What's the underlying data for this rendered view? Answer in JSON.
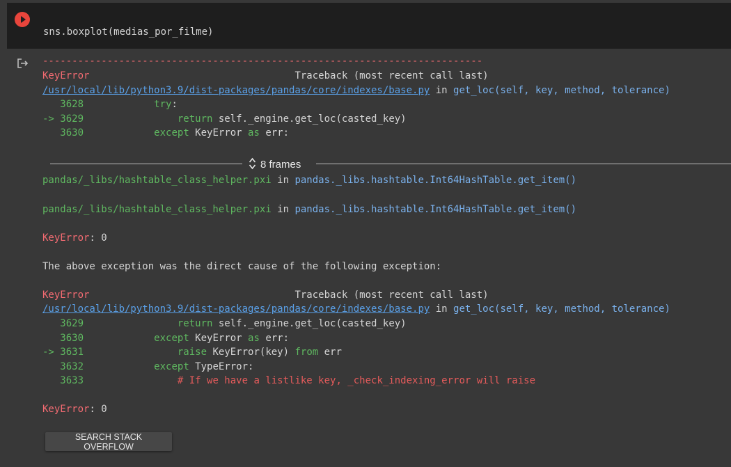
{
  "cell": {
    "code": "sns.boxplot(medias_por_filme)",
    "run_icon": "run-error-icon"
  },
  "output": {
    "output_icon": "output-redirect-icon",
    "separator": "---------------------------------------------------------------------------",
    "tb1": {
      "error": "KeyError",
      "traceback": "Traceback (most recent call last)",
      "path": "/usr/local/lib/python3.9/dist-packages/pandas/core/indexes/base.py",
      "in": " in ",
      "func": "get_loc(self, key, method, tolerance)",
      "lines": [
        {
          "prefix": "   ",
          "num": "3628",
          "indent": "            ",
          "code": [
            {
              "t": "try",
              "c": "green"
            },
            {
              "t": ":",
              "c": "plain"
            }
          ]
        },
        {
          "prefix": "-> ",
          "num": "3629",
          "indent": "                ",
          "code": [
            {
              "t": "return",
              "c": "green"
            },
            {
              "t": " self._engine.get_loc(casted_key)",
              "c": "plain"
            }
          ]
        },
        {
          "prefix": "   ",
          "num": "3630",
          "indent": "            ",
          "code": [
            {
              "t": "except",
              "c": "green"
            },
            {
              "t": " KeyError ",
              "c": "plain"
            },
            {
              "t": "as",
              "c": "green"
            },
            {
              "t": " err:",
              "c": "plain"
            }
          ]
        }
      ]
    },
    "frames_label": "8 frames",
    "frame1": {
      "file": "pandas/_libs/hashtable_class_helper.pxi",
      "in": " in ",
      "func": "pandas._libs.hashtable.Int64HashTable.get_item()"
    },
    "frame2": {
      "file": "pandas/_libs/hashtable_class_helper.pxi",
      "in": " in ",
      "func": "pandas._libs.hashtable.Int64HashTable.get_item()"
    },
    "error1": {
      "name": "KeyError",
      "msg": ": 0"
    },
    "cause_text": "The above exception was the direct cause of the following exception:",
    "tb2": {
      "error": "KeyError",
      "traceback": "Traceback (most recent call last)",
      "path": "/usr/local/lib/python3.9/dist-packages/pandas/core/indexes/base.py",
      "in": " in ",
      "func": "get_loc(self, key, method, tolerance)",
      "lines": [
        {
          "prefix": "   ",
          "num": "3629",
          "indent": "                ",
          "code": [
            {
              "t": "return",
              "c": "green"
            },
            {
              "t": " self._engine.get_loc(casted_key)",
              "c": "plain"
            }
          ]
        },
        {
          "prefix": "   ",
          "num": "3630",
          "indent": "            ",
          "code": [
            {
              "t": "except",
              "c": "green"
            },
            {
              "t": " KeyError ",
              "c": "plain"
            },
            {
              "t": "as",
              "c": "green"
            },
            {
              "t": " err:",
              "c": "plain"
            }
          ]
        },
        {
          "prefix": "-> ",
          "num": "3631",
          "indent": "                ",
          "code": [
            {
              "t": "raise",
              "c": "green"
            },
            {
              "t": " KeyError(key) ",
              "c": "plain"
            },
            {
              "t": "from",
              "c": "green"
            },
            {
              "t": " err",
              "c": "plain"
            }
          ]
        },
        {
          "prefix": "   ",
          "num": "3632",
          "indent": "            ",
          "code": [
            {
              "t": "except",
              "c": "green"
            },
            {
              "t": " TypeError:",
              "c": "plain"
            }
          ]
        },
        {
          "prefix": "   ",
          "num": "3633",
          "indent": "                ",
          "code": [
            {
              "t": "# If we have a listlike key, _check_indexing_error will raise",
              "c": "redc"
            }
          ]
        }
      ]
    },
    "error2": {
      "name": "KeyError",
      "msg": ": 0"
    },
    "so_button": "SEARCH STACK OVERFLOW"
  }
}
